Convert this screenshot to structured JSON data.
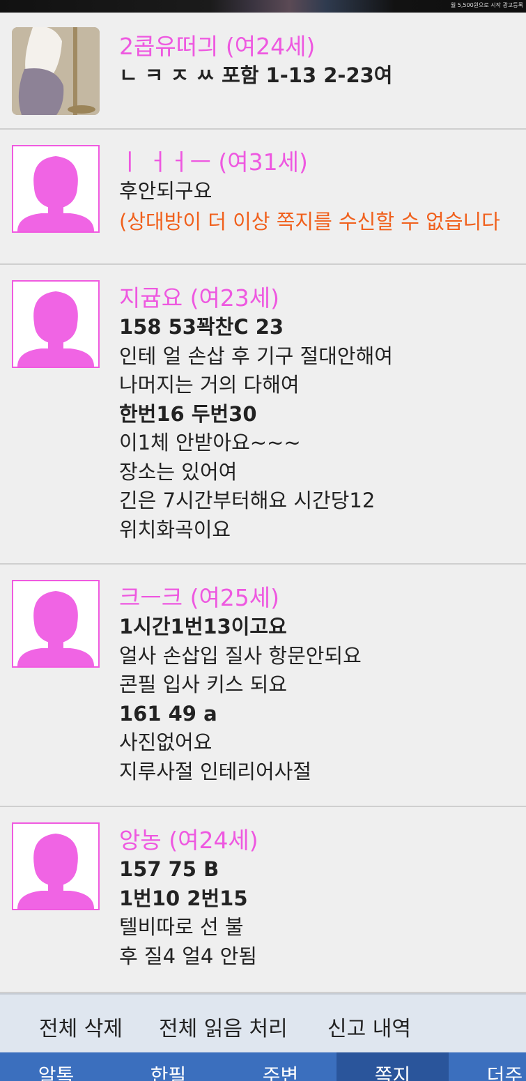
{
  "top_banner": {
    "text": "월 5,500원으로 시작 광고등록"
  },
  "messages": [
    {
      "sender": "2콥유떠긔 (여24세)",
      "avatar": "photo",
      "lines": [
        "ㄴ ㅋ ㅈ ㅆ 포함 1-13 2-23여"
      ],
      "notice": ""
    },
    {
      "sender": "ㅣ ㅓㅓㅡ (여31세)",
      "avatar": "female-silhouette-icon",
      "lines": [
        "후안되구요"
      ],
      "notice": "(상대방이 더 이상 쪽지를 수신할 수 없습니다"
    },
    {
      "sender": "지귬요 (여23세)",
      "avatar": "female-silhouette-icon",
      "lines": [
        "158 53꽉찬C 23",
        "인테 얼 손삽 후 기구 절대안해여",
        "나머지는 거의 다해여",
        "한번16 두번30",
        "이1체 안받아요~~~",
        "장소는 있어여",
        "긴은 7시간부터해요 시간당12",
        "위치화곡이요"
      ],
      "notice": ""
    },
    {
      "sender": "크ㅡ크 (여25세)",
      "avatar": "female-silhouette-icon",
      "lines": [
        "1시간1번13이고요",
        "얼사 손삽입 질사 항문안되요",
        "콘필 입사 키스 되요",
        "161 49 a",
        "사진없어요",
        "지루사절 인테리어사절"
      ],
      "notice": ""
    },
    {
      "sender": "앙농 (여24세)",
      "avatar": "female-silhouette-icon",
      "lines": [
        "157 75 B",
        "1번10 2번15",
        "텔비따로 선 불",
        "후 질4 얼4 안됨"
      ],
      "notice": ""
    }
  ],
  "actions": {
    "delete_all": "전체 삭제",
    "mark_all_read": "전체 읽음 처리",
    "report_history": "신고 내역"
  },
  "nav": {
    "tabs": [
      "알톡",
      "한필",
      "주변",
      "쪽지",
      "더주"
    ],
    "active_index": 3
  },
  "colors": {
    "sender": "#ee58e0",
    "notice": "#f0601c",
    "avatar_border": "#f05ae0",
    "nav_bg": "#3b6fbe",
    "nav_active": "#2a559b",
    "action_bar_bg": "#dfe6ef"
  }
}
